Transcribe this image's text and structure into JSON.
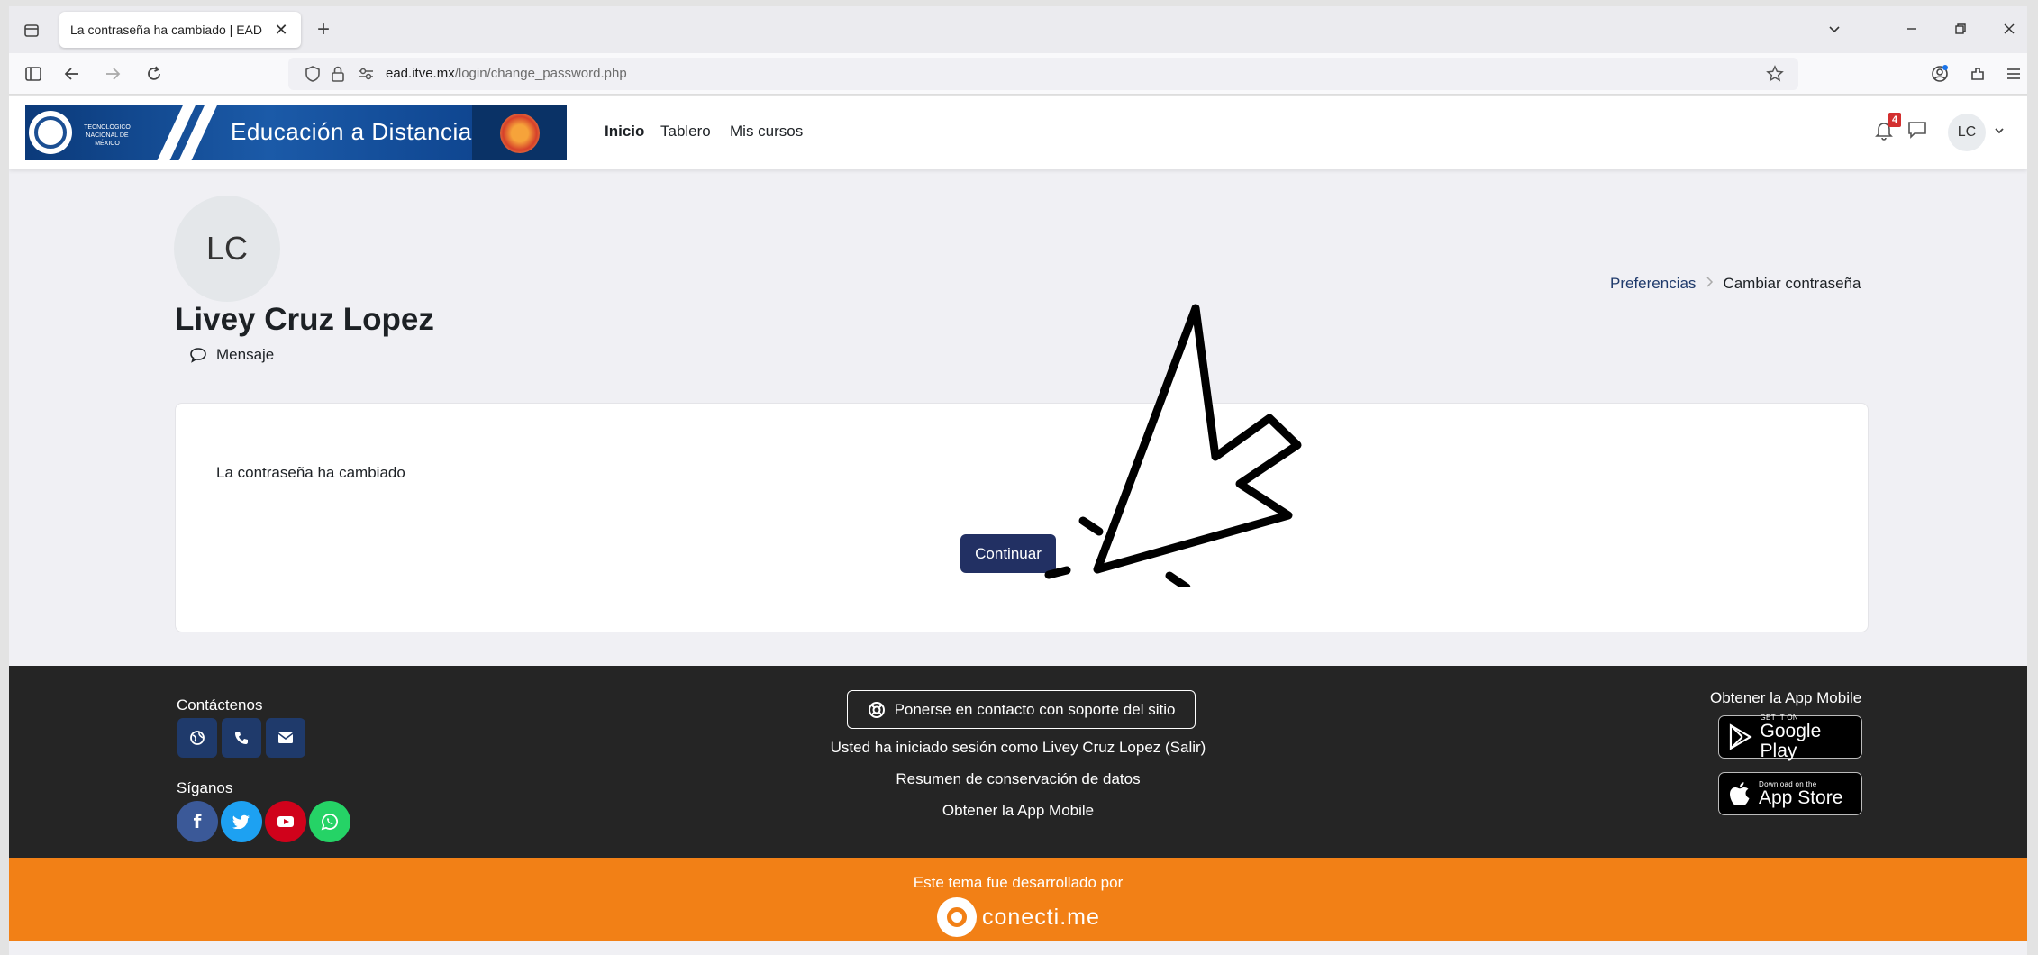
{
  "browser": {
    "tab_title": "La contraseña ha cambiado | EAD",
    "tab_close": "✕",
    "new_tab": "+",
    "url_domain": "ead.itve.mx",
    "url_path": "/login/change_password.php"
  },
  "header": {
    "logo_small_text": "TECNOLÓGICO NACIONAL DE MÉXICO",
    "logo_title": "Educación a Distancia",
    "nav": [
      {
        "label": "Inicio"
      },
      {
        "label": "Tablero"
      },
      {
        "label": "Mis cursos"
      }
    ],
    "notification_count": "4",
    "user_initials": "LC"
  },
  "profile": {
    "initials": "LC",
    "name": "Livey Cruz Lopez",
    "message_label": "Mensaje"
  },
  "breadcrumb": {
    "items": [
      "Preferencias",
      "Cambiar contraseña"
    ]
  },
  "card": {
    "message": "La contraseña ha cambiado",
    "continue_label": "Continuar"
  },
  "footer": {
    "contact_heading": "Contáctenos",
    "follow_heading": "Síganos",
    "support_label": "Ponerse en contacto con soporte del sitio",
    "logged_in_text": "Usted ha iniciado sesión como Livey Cruz Lopez (Salir)",
    "data_retention_label": "Resumen de conservación de datos",
    "mobile_app_link": "Obtener la App Mobile",
    "app_heading": "Obtener la App Mobile",
    "google_play_small": "GET IT ON",
    "google_play_big": "Google Play",
    "app_store_small": "Download on the",
    "app_store_big": "App Store"
  },
  "credit": {
    "text": "Este tema fue desarrollado por",
    "brand": "conecti.me"
  },
  "colors": {
    "primary": "#223063",
    "footer_bg": "#252525",
    "credit_bg": "#f28016",
    "facebook": "#3b5998",
    "twitter": "#1da1f2",
    "youtube": "#d0021b",
    "whatsapp": "#25d366"
  }
}
